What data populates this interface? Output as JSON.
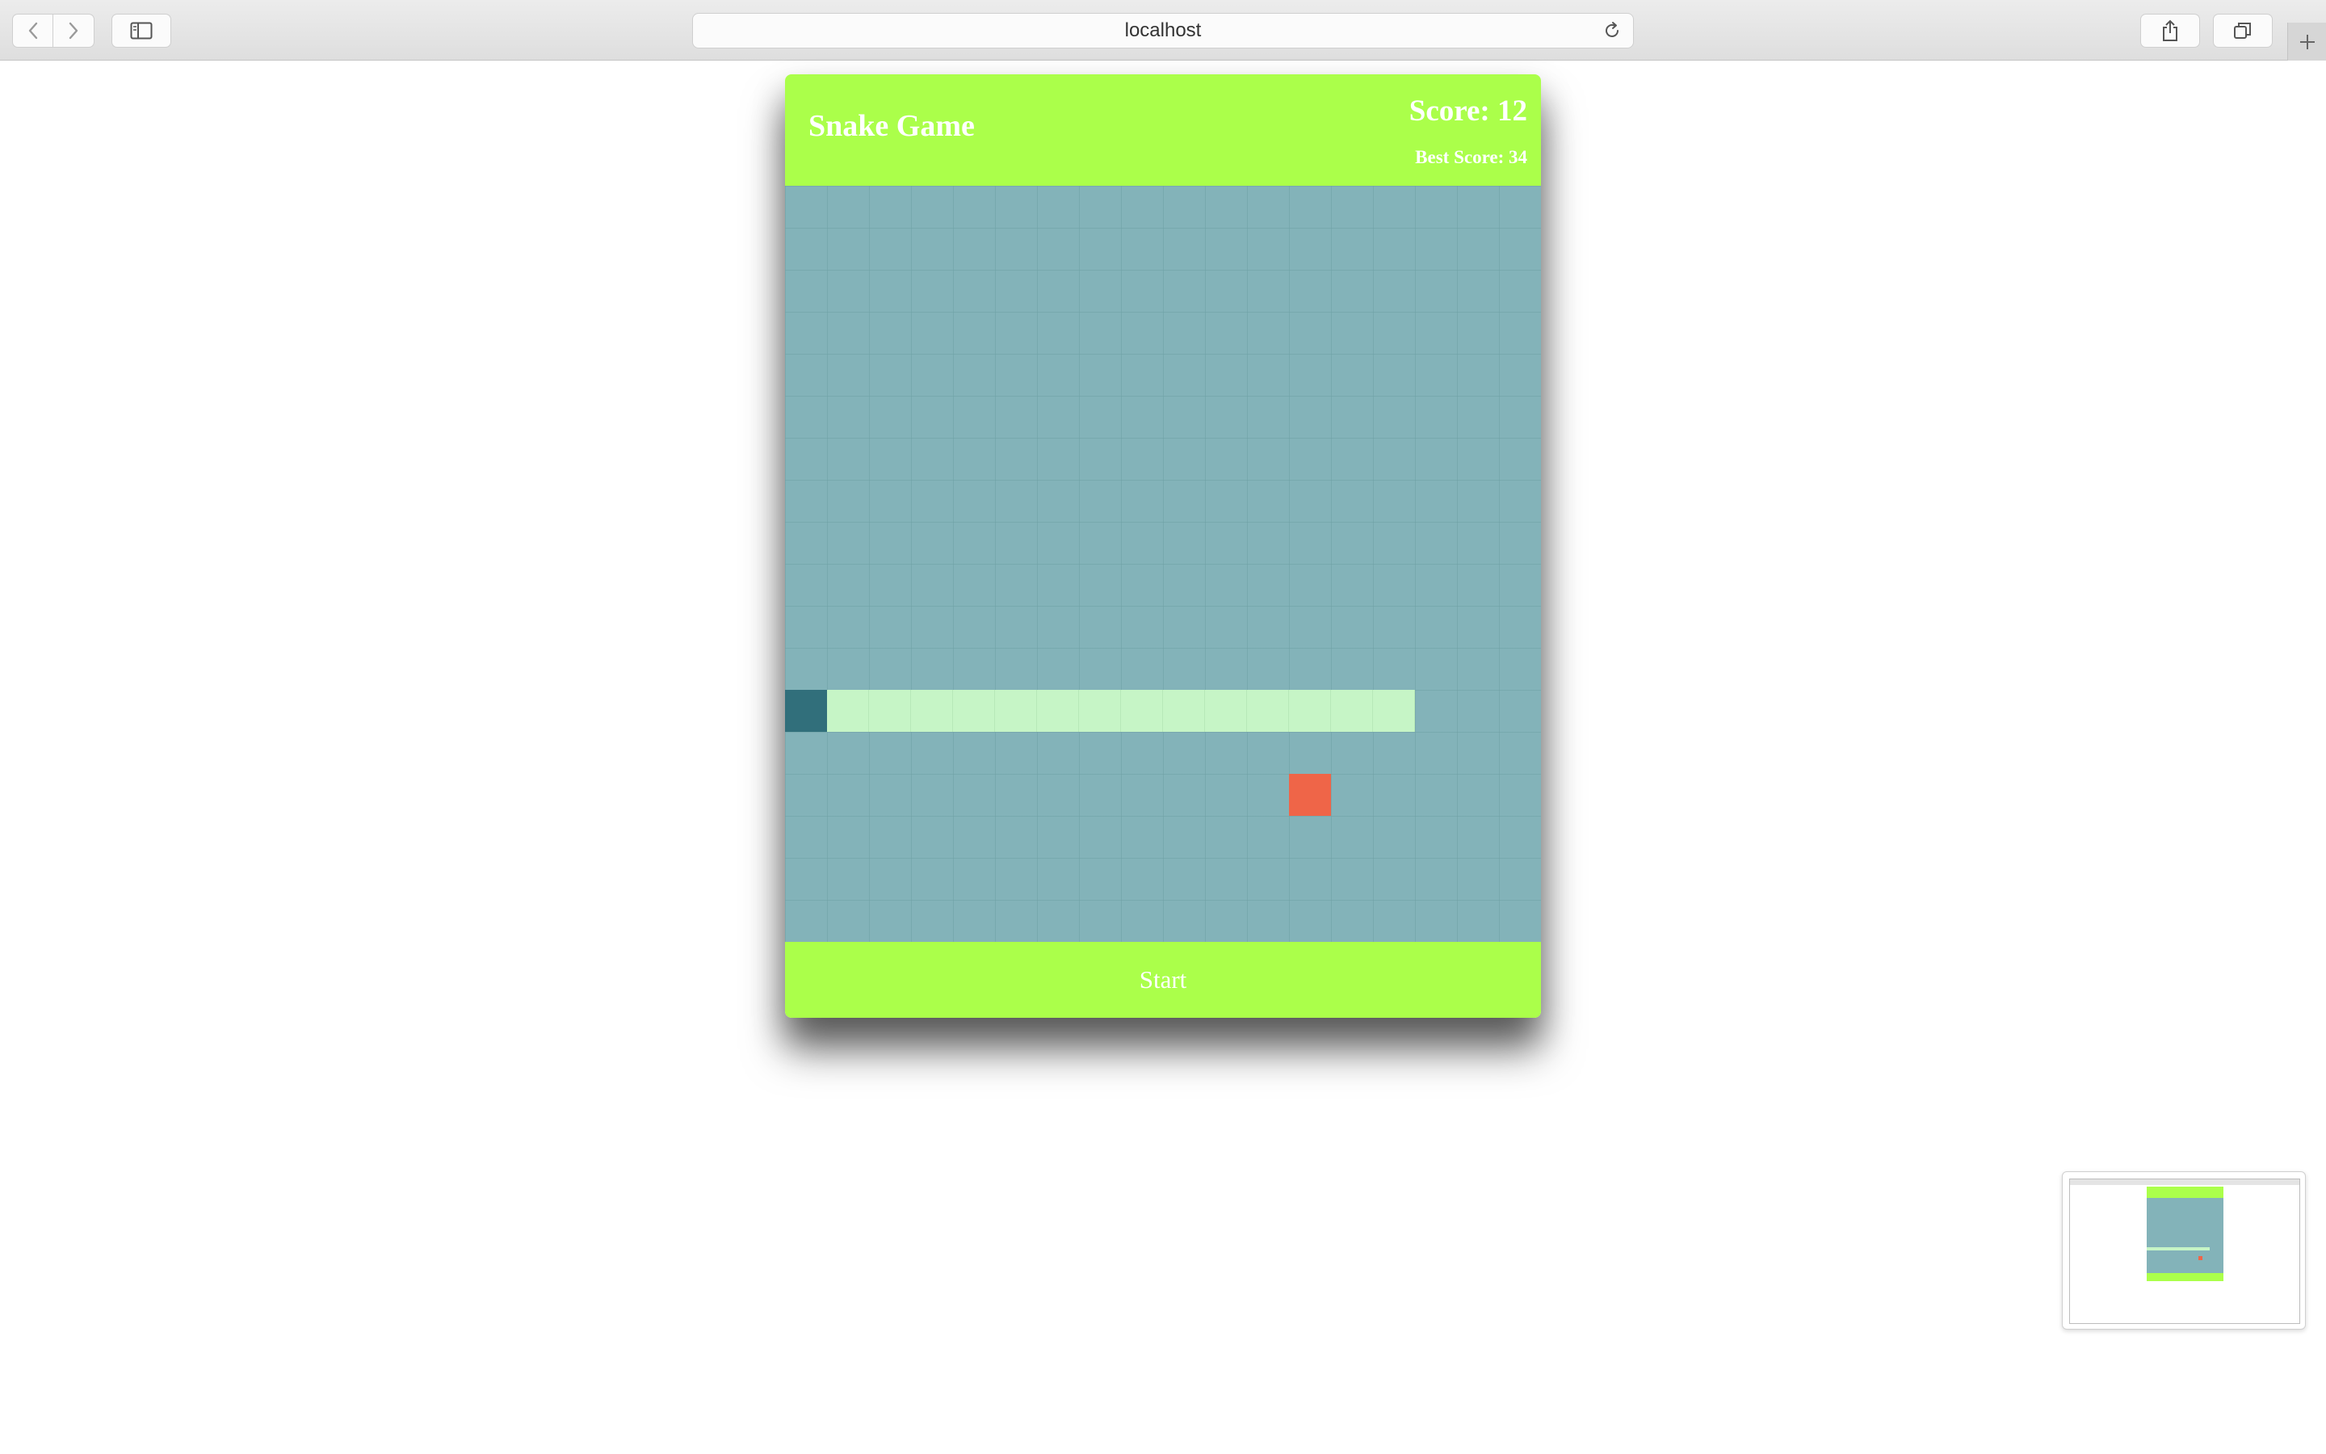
{
  "browser": {
    "url": "localhost"
  },
  "game": {
    "title": "Snake Game",
    "score_text": "Score: 12",
    "best_score_text": "Best Score: 34",
    "start_label": "Start",
    "grid": {
      "columns": 18,
      "rows": 18
    },
    "snake": {
      "head": [
        0,
        12
      ],
      "body": [
        [
          1,
          12
        ],
        [
          2,
          12
        ],
        [
          3,
          12
        ],
        [
          4,
          12
        ],
        [
          5,
          12
        ],
        [
          6,
          12
        ],
        [
          7,
          12
        ],
        [
          8,
          12
        ],
        [
          9,
          12
        ],
        [
          10,
          12
        ],
        [
          11,
          12
        ],
        [
          12,
          12
        ],
        [
          13,
          12
        ],
        [
          14,
          12
        ]
      ]
    },
    "food": [
      12,
      14
    ],
    "colors": {
      "header": "#abff4a",
      "board": "#83b3b9",
      "snake_head": "#316f7b",
      "snake_body": "#c6f5c6",
      "food": "#ef6548"
    }
  }
}
